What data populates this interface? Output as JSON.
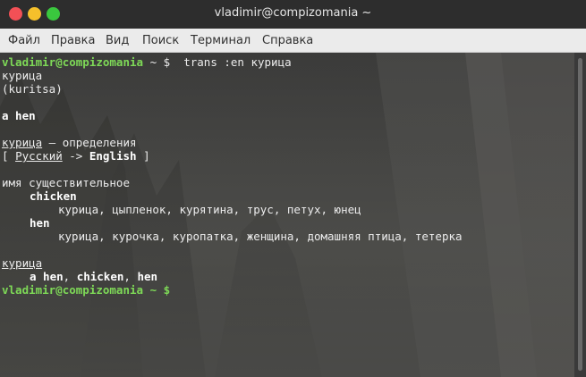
{
  "window": {
    "title": "vladimir@compizomania ~"
  },
  "menu": {
    "items": [
      "Файл",
      "Правка",
      "Вид",
      "Поиск",
      "Терминал",
      "Справка"
    ]
  },
  "colors": {
    "prompt": "#7ed957",
    "text": "#ececec",
    "close": "#f25056",
    "minimize": "#f5c02b",
    "maximize": "#3ac73e"
  },
  "terminal": {
    "prompt": "vladimir@compizomania",
    "prompt_suffix": " ~ $ ",
    "command": " trans :en курица",
    "word": "курица",
    "transliteration": "(kuritsa)",
    "translation": "a hen",
    "definitions_word": "курица",
    "definitions_suffix": " — определения",
    "lang_open": "[ ",
    "lang_from": "Русский",
    "lang_arrow": " -> ",
    "lang_to": "English",
    "lang_close": " ]",
    "pos": "имя существительное",
    "entries": [
      {
        "word": "chicken",
        "synonyms": "курица, цыпленок, курятина, трус, петух, юнец"
      },
      {
        "word": "hen",
        "synonyms": "курица, курочка, куропатка, женщина, домашняя птица, тетерка"
      }
    ],
    "example_word": "курица",
    "example_parts": [
      "a hen",
      ", ",
      "chicken",
      ", ",
      "hen"
    ],
    "final_prompt_suffix": " ~ $"
  }
}
